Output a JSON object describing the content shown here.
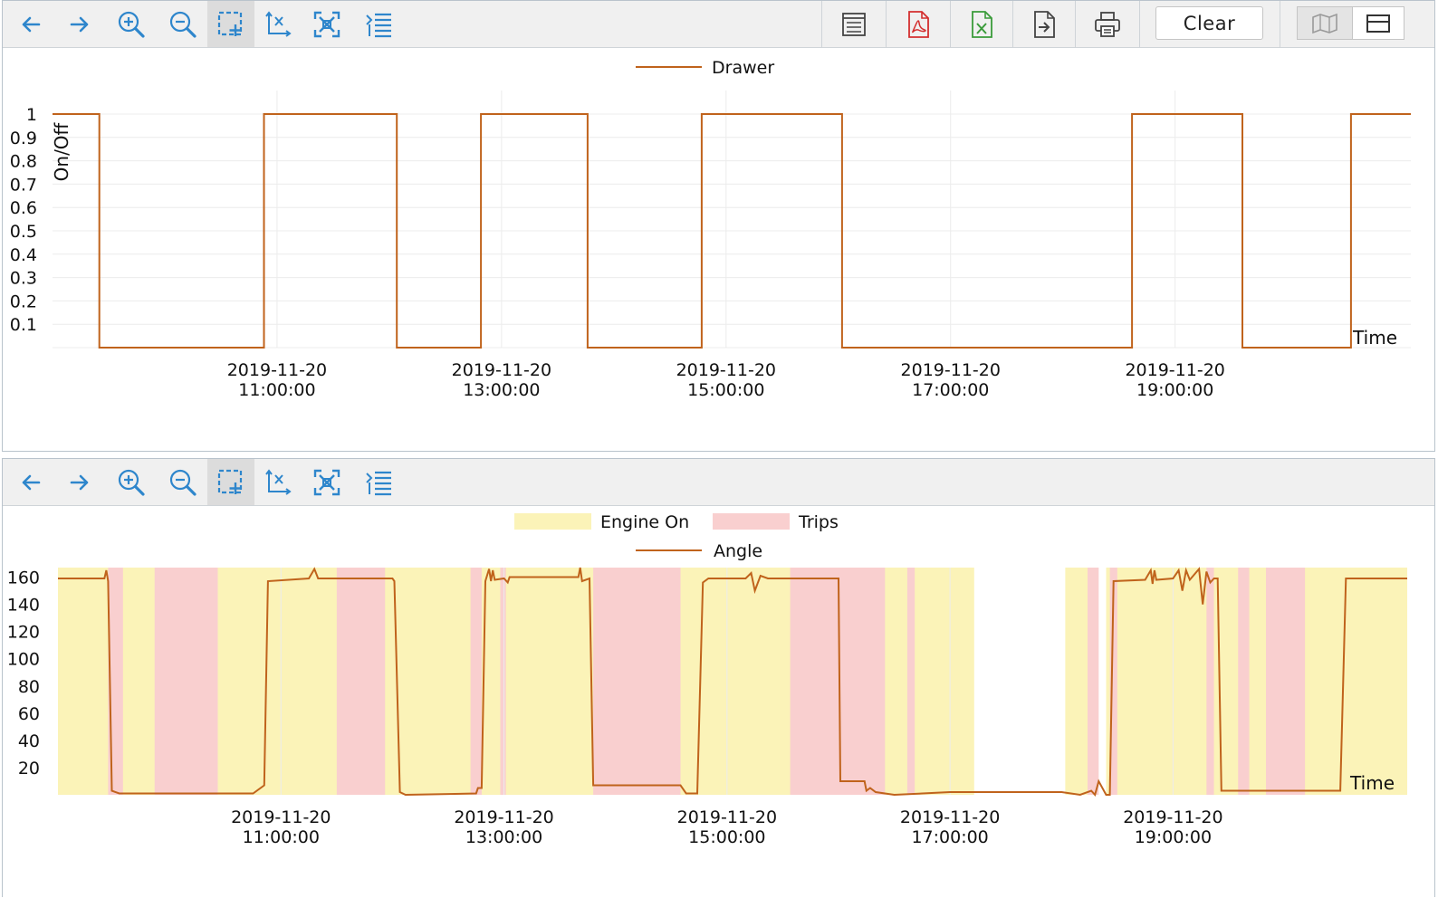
{
  "toolbar": {
    "icons": [
      "arrow-left-icon",
      "arrow-right-icon",
      "zoom-in-icon",
      "zoom-out-icon",
      "box-select-icon",
      "reset-axes-icon",
      "fit-to-screen-icon",
      "list-icon"
    ],
    "export_icons": [
      "view-data-icon",
      "pdf-icon",
      "excel-icon",
      "export-file-icon",
      "print-icon"
    ],
    "clear_label": "Clear",
    "layout_icons": [
      "map-icon",
      "stacked-layout-icon"
    ]
  },
  "colors": {
    "series_line": "#c0631c",
    "engine_on": "#fbf3b8",
    "trips": "#f9cfcf",
    "grid": "#ececec",
    "icon_blue": "#2e86cc"
  },
  "chart_data": [
    {
      "type": "line",
      "legend": [
        {
          "name": "Drawer",
          "style": "line"
        }
      ],
      "ylabel": "On/Off",
      "xlabel": "Time",
      "yticks": [
        "0.1",
        "0.2",
        "0.3",
        "0.4",
        "0.5",
        "0.6",
        "0.7",
        "0.8",
        "0.9",
        "1"
      ],
      "ylim": [
        0,
        1
      ],
      "xlim": [
        "2019-11-20 09:00",
        "2019-11-20 21:06"
      ],
      "xticks": [
        {
          "t": "2019-11-20 11:00",
          "l1": "2019-11-20",
          "l2": "11:00:00"
        },
        {
          "t": "2019-11-20 13:00",
          "l1": "2019-11-20",
          "l2": "13:00:00"
        },
        {
          "t": "2019-11-20 15:00",
          "l1": "2019-11-20",
          "l2": "15:00:00"
        },
        {
          "t": "2019-11-20 17:00",
          "l1": "2019-11-20",
          "l2": "17:00:00"
        },
        {
          "t": "2019-11-20 19:00",
          "l1": "2019-11-20",
          "l2": "19:00:00"
        }
      ],
      "series": [
        {
          "name": "Drawer",
          "points": [
            [
              "2019-11-20 09:00",
              1
            ],
            [
              "2019-11-20 09:25",
              1
            ],
            [
              "2019-11-20 09:25",
              0
            ],
            [
              "2019-11-20 10:53",
              0
            ],
            [
              "2019-11-20 10:53",
              1
            ],
            [
              "2019-11-20 12:04",
              1
            ],
            [
              "2019-11-20 12:04",
              0
            ],
            [
              "2019-11-20 12:49",
              0
            ],
            [
              "2019-11-20 12:49",
              1
            ],
            [
              "2019-11-20 13:46",
              1
            ],
            [
              "2019-11-20 13:46",
              0
            ],
            [
              "2019-11-20 14:47",
              0
            ],
            [
              "2019-11-20 14:47",
              1
            ],
            [
              "2019-11-20 16:02",
              1
            ],
            [
              "2019-11-20 16:02",
              0
            ],
            [
              "2019-11-20 18:37",
              0
            ],
            [
              "2019-11-20 18:37",
              1
            ],
            [
              "2019-11-20 19:36",
              1
            ],
            [
              "2019-11-20 19:36",
              0
            ],
            [
              "2019-11-20 20:34",
              0
            ],
            [
              "2019-11-20 20:34",
              1
            ],
            [
              "2019-11-20 21:06",
              1
            ]
          ]
        }
      ]
    },
    {
      "type": "line",
      "legend": [
        {
          "name": "Engine On",
          "style": "band",
          "color": "#fbf3b8"
        },
        {
          "name": "Trips",
          "style": "band",
          "color": "#f9cfcf"
        },
        {
          "name": "Angle",
          "style": "line"
        }
      ],
      "xlabel": "Time",
      "yticks": [
        "20",
        "40",
        "60",
        "80",
        "100",
        "120",
        "140",
        "160"
      ],
      "ylim": [
        0,
        167
      ],
      "xlim": [
        "2019-11-20 09:00",
        "2019-11-20 21:06"
      ],
      "xticks": [
        {
          "t": "2019-11-20 11:00",
          "l1": "2019-11-20",
          "l2": "11:00:00"
        },
        {
          "t": "2019-11-20 13:00",
          "l1": "2019-11-20",
          "l2": "13:00:00"
        },
        {
          "t": "2019-11-20 15:00",
          "l1": "2019-11-20",
          "l2": "15:00:00"
        },
        {
          "t": "2019-11-20 17:00",
          "l1": "2019-11-20",
          "l2": "17:00:00"
        },
        {
          "t": "2019-11-20 19:00",
          "l1": "2019-11-20",
          "l2": "19:00:00"
        }
      ],
      "engine_on": [
        [
          "2019-11-20 09:00",
          "2019-11-20 17:13"
        ],
        [
          "2019-11-20 18:02",
          "2019-11-20 18:18"
        ],
        [
          "2019-11-20 18:24",
          "2019-11-20 21:06"
        ]
      ],
      "trips": [
        [
          "2019-11-20 09:27",
          "2019-11-20 09:35"
        ],
        [
          "2019-11-20 09:52",
          "2019-11-20 10:26"
        ],
        [
          "2019-11-20 11:30",
          "2019-11-20 11:56"
        ],
        [
          "2019-11-20 12:42",
          "2019-11-20 12:48"
        ],
        [
          "2019-11-20 12:58",
          "2019-11-20 13:01"
        ],
        [
          "2019-11-20 13:48",
          "2019-11-20 14:35"
        ],
        [
          "2019-11-20 15:34",
          "2019-11-20 16:25"
        ],
        [
          "2019-11-20 16:37",
          "2019-11-20 16:41"
        ],
        [
          "2019-11-20 18:14",
          "2019-11-20 18:20"
        ],
        [
          "2019-11-20 18:26",
          "2019-11-20 18:30"
        ],
        [
          "2019-11-20 19:18",
          "2019-11-20 19:22"
        ],
        [
          "2019-11-20 19:35",
          "2019-11-20 19:41"
        ],
        [
          "2019-11-20 19:50",
          "2019-11-20 20:11"
        ]
      ],
      "series": [
        {
          "name": "Angle",
          "points": [
            [
              "2019-11-20 09:00",
              159
            ],
            [
              "2019-11-20 09:25",
              159
            ],
            [
              "2019-11-20 09:26",
              165
            ],
            [
              "2019-11-20 09:27",
              157
            ],
            [
              "2019-11-20 09:29",
              3
            ],
            [
              "2019-11-20 09:33",
              1
            ],
            [
              "2019-11-20 10:45",
              1
            ],
            [
              "2019-11-20 10:51",
              7
            ],
            [
              "2019-11-20 10:53",
              157
            ],
            [
              "2019-11-20 11:15",
              159
            ],
            [
              "2019-11-20 11:18",
              166
            ],
            [
              "2019-11-20 11:20",
              159
            ],
            [
              "2019-11-20 12:00",
              159
            ],
            [
              "2019-11-20 12:01",
              157
            ],
            [
              "2019-11-20 12:04",
              2
            ],
            [
              "2019-11-20 12:07",
              0
            ],
            [
              "2019-11-20 12:45",
              1
            ],
            [
              "2019-11-20 12:46",
              5
            ],
            [
              "2019-11-20 12:48",
              5
            ],
            [
              "2019-11-20 12:50",
              157
            ],
            [
              "2019-11-20 12:52",
              166
            ],
            [
              "2019-11-20 12:53",
              157
            ],
            [
              "2019-11-20 12:54",
              165
            ],
            [
              "2019-11-20 12:55",
              158
            ],
            [
              "2019-11-20 13:00",
              159
            ],
            [
              "2019-11-20 13:02",
              156
            ],
            [
              "2019-11-20 13:03",
              160
            ],
            [
              "2019-11-20 13:40",
              160
            ],
            [
              "2019-11-20 13:41",
              167
            ],
            [
              "2019-11-20 13:42",
              157
            ],
            [
              "2019-11-20 13:46",
              159
            ],
            [
              "2019-11-20 13:48",
              7
            ],
            [
              "2019-11-20 14:35",
              7
            ],
            [
              "2019-11-20 14:38",
              1
            ],
            [
              "2019-11-20 14:44",
              1
            ],
            [
              "2019-11-20 14:47",
              156
            ],
            [
              "2019-11-20 14:50",
              159
            ],
            [
              "2019-11-20 15:10",
              159
            ],
            [
              "2019-11-20 15:13",
              163
            ],
            [
              "2019-11-20 15:15",
              150
            ],
            [
              "2019-11-20 15:18",
              161
            ],
            [
              "2019-11-20 15:22",
              159
            ],
            [
              "2019-11-20 16:00",
              159
            ],
            [
              "2019-11-20 16:01",
              10
            ],
            [
              "2019-11-20 16:14",
              10
            ],
            [
              "2019-11-20 16:15",
              3
            ],
            [
              "2019-11-20 16:17",
              5
            ],
            [
              "2019-11-20 16:20",
              2
            ],
            [
              "2019-11-20 16:30",
              0
            ],
            [
              "2019-11-20 17:00",
              2
            ],
            [
              "2019-11-20 17:30",
              2
            ],
            [
              "2019-11-20 18:00",
              2
            ],
            [
              "2019-11-20 18:10",
              0
            ],
            [
              "2019-11-20 18:16",
              3
            ],
            [
              "2019-11-20 18:18",
              0
            ],
            [
              "2019-11-20 18:20",
              10
            ],
            [
              "2019-11-20 18:24",
              0
            ],
            [
              "2019-11-20 18:26",
              0
            ],
            [
              "2019-11-20 18:28",
              157
            ],
            [
              "2019-11-20 18:45",
              158
            ],
            [
              "2019-11-20 18:48",
              165
            ],
            [
              "2019-11-20 18:49",
              155
            ],
            [
              "2019-11-20 18:50",
              165
            ],
            [
              "2019-11-20 18:51",
              158
            ],
            [
              "2019-11-20 19:00",
              159
            ],
            [
              "2019-11-20 19:03",
              165
            ],
            [
              "2019-11-20 19:05",
              150
            ],
            [
              "2019-11-20 19:07",
              165
            ],
            [
              "2019-11-20 19:09",
              158
            ],
            [
              "2019-11-20 19:14",
              166
            ],
            [
              "2019-11-20 19:16",
              140
            ],
            [
              "2019-11-20 19:18",
              164
            ],
            [
              "2019-11-20 19:20",
              156
            ],
            [
              "2019-11-20 19:22",
              159
            ],
            [
              "2019-11-20 19:24",
              159
            ],
            [
              "2019-11-20 19:26",
              3
            ],
            [
              "2019-11-20 20:30",
              3
            ],
            [
              "2019-11-20 20:33",
              159
            ],
            [
              "2019-11-20 21:06",
              159
            ]
          ]
        }
      ]
    }
  ]
}
